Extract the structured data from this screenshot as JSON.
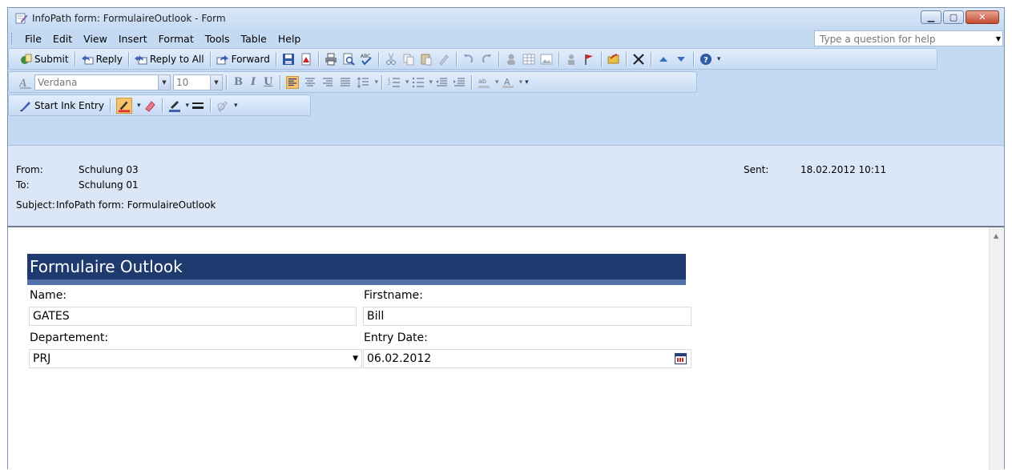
{
  "window": {
    "title": "InfoPath form: FormulaireOutlook - Form",
    "buttons": {
      "minimize": "▁",
      "restore": "▢",
      "close": "✕"
    }
  },
  "menu": {
    "items": [
      "File",
      "Edit",
      "View",
      "Insert",
      "Format",
      "Tools",
      "Table",
      "Help"
    ],
    "help_placeholder": "Type a question for help"
  },
  "toolbar1": {
    "submit": "Submit",
    "reply": "Reply",
    "reply_all": "Reply to All",
    "forward": "Forward"
  },
  "toolbar2": {
    "font": "Verdana",
    "size": "10",
    "bold": "B",
    "italic": "I",
    "underline": "U"
  },
  "toolbar3": {
    "start_ink": "Start Ink Entry"
  },
  "header": {
    "from_label": "From:",
    "from_value": "Schulung 03",
    "to_label": "To:",
    "to_value": "Schulung 01",
    "subject_label": "Subject:",
    "subject_value": "InfoPath form: FormulaireOutlook",
    "sent_label": "Sent:",
    "sent_value": "18.02.2012 10:11"
  },
  "form": {
    "title": "Formulaire Outlook",
    "name_label": "Name:",
    "name_value": "GATES",
    "firstname_label": "Firstname:",
    "firstname_value": "Bill",
    "department_label": "Departement:",
    "department_value": "PRJ",
    "entry_date_label": "Entry Date:",
    "entry_date_value": "06.02.2012"
  },
  "colors": {
    "form_title_bg": "#1f3a6e",
    "form_band": "#4f71a8",
    "chrome": "#c4daf3",
    "header_bg": "#dbe7f6"
  }
}
